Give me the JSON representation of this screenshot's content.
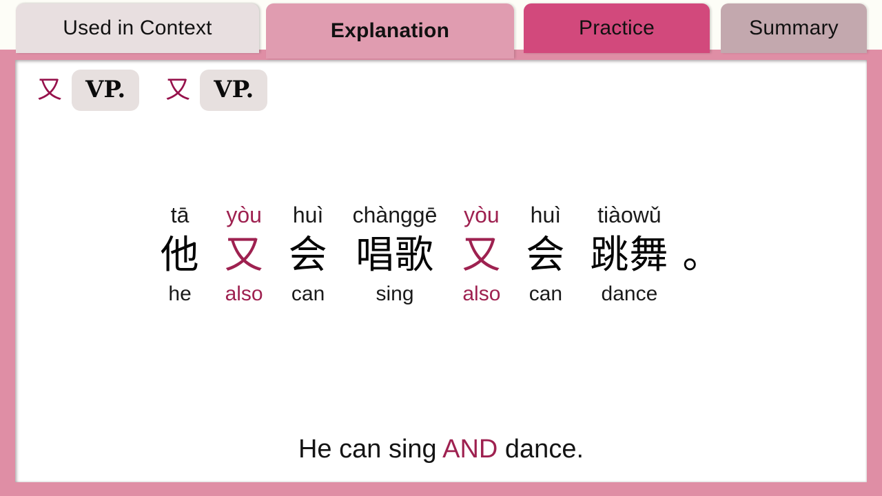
{
  "theme": {
    "frame_pink": "#df8ea5",
    "accent_magenta": "#9e2150",
    "pattern_crimson": "#96114b",
    "active_tab_pink": "#e09cb0",
    "practice_tab_pink": "#d2497c",
    "summary_tab_mauve": "#c3a8ae",
    "inactive_tab_gray": "#e8dfe0",
    "chip_gray": "#e7e0df",
    "page_background": "#fdfdf7"
  },
  "tabs": [
    {
      "id": "used-in-context",
      "label": "Used in Context",
      "active": false
    },
    {
      "id": "explanation",
      "label": "Explanation",
      "active": true
    },
    {
      "id": "practice",
      "label": "Practice",
      "active": false
    },
    {
      "id": "summary",
      "label": "Summary",
      "active": false
    }
  ],
  "pattern": {
    "char_1": "又",
    "box_1": "VP.",
    "char_2": "又",
    "box_2": "VP."
  },
  "sentence": {
    "words": [
      {
        "pinyin": "tā",
        "hanzi": "他",
        "gloss": "he",
        "accent": false
      },
      {
        "pinyin": "yòu",
        "hanzi": "又",
        "gloss": "also",
        "accent": true
      },
      {
        "pinyin": "huì",
        "hanzi": "会",
        "gloss": "can",
        "accent": false
      },
      {
        "pinyin": "chànggē",
        "hanzi": "唱歌",
        "gloss": "sing",
        "accent": false
      },
      {
        "pinyin": "yòu",
        "hanzi": "又",
        "gloss": "also",
        "accent": true
      },
      {
        "pinyin": "huì",
        "hanzi": "会",
        "gloss": "can",
        "accent": false
      },
      {
        "pinyin": "tiàowǔ",
        "hanzi": "跳舞",
        "gloss": "dance",
        "accent": false
      }
    ],
    "punctuation": "。"
  },
  "translation": {
    "before": "He can sing ",
    "highlight": "AND",
    "after": " dance."
  }
}
